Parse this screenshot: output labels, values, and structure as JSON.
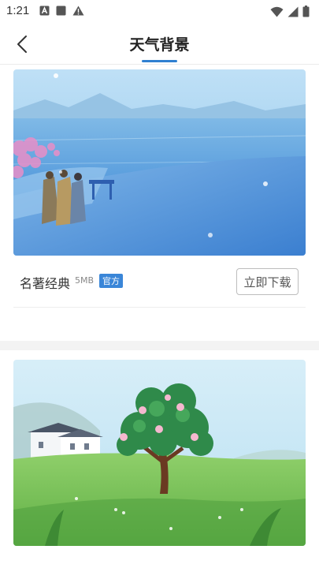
{
  "status_bar": {
    "time": "1:21",
    "icons_left": [
      "a-notification-icon",
      "square-notification-icon",
      "warning-icon"
    ],
    "icons_right": [
      "wifi-icon",
      "signal-icon",
      "battery-icon"
    ]
  },
  "nav": {
    "title": "天气背景",
    "accent_color": "#2f80d1"
  },
  "cards": [
    {
      "title": "名著经典",
      "size": "5MB",
      "badge": "官方",
      "download_label": "立即下载",
      "scene": "lake-with-robed-figures"
    },
    {
      "title": "",
      "size": "",
      "badge": "",
      "download_label": "",
      "scene": "green-tree-field"
    }
  ]
}
